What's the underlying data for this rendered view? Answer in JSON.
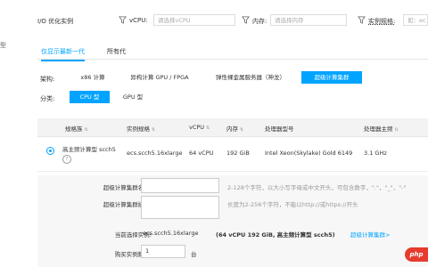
{
  "sidebar": {
    "label": "型"
  },
  "filters": {
    "io_label": "I/O 优化实例",
    "vcpu_label": "vCPU:",
    "vcpu_placeholder": "请选择vCPU",
    "memory_label": "内存:",
    "memory_placeholder": "请选择内存",
    "spec_label": "实例规格:",
    "spec_placeholder": "如：ec"
  },
  "gen_tabs": [
    {
      "label": "仅显示最新一代",
      "active": true
    },
    {
      "label": "所有代",
      "active": false
    }
  ],
  "arch": {
    "label": "架构:",
    "options": [
      {
        "label": "x86 计算",
        "active": false
      },
      {
        "label": "异构计算 GPU / FPGA",
        "active": false
      },
      {
        "label": "弹性裸金属服务器（神龙）",
        "active": false
      },
      {
        "label": "超级计算集群",
        "active": true
      }
    ]
  },
  "category": {
    "label": "分类:",
    "options": [
      {
        "label": "CPU 型",
        "active": true
      },
      {
        "label": "GPU 型",
        "active": false
      }
    ]
  },
  "table": {
    "headers": [
      "规格族",
      "实例规格",
      "vCPU",
      "内存",
      "处理器型号",
      "处理器主频"
    ],
    "rows": [
      {
        "family": "高主频计算型 scch5",
        "spec": "ecs.scch5.16xlarge",
        "vcpu": "64 vCPU",
        "memory": "192 GiB",
        "cpu_model": "Intel Xeon(Skylake) Gold 6149",
        "freq": "3.1 GHz"
      }
    ]
  },
  "form": {
    "name_label": "超级计算集群名称:",
    "name_hint": "2-128个字符，以大小写字母或中文开头，可包含数字，\".\"，\"_\"，\"-\"",
    "desc_label": "超级计算集群描述:",
    "desc_hint": "长度为2-256个字符，不能以http://或https://开头",
    "current_label": "当前选择实例:",
    "current_spec": "ecs.scch5.16xlarge",
    "current_detail": "(64 vCPU 192 GiB, 高主频计算型 scch5)",
    "current_link": "超级计算集群>",
    "qty_label": "购买实例数量:",
    "qty_value": "1",
    "qty_unit": "台"
  },
  "watermark": "php"
}
